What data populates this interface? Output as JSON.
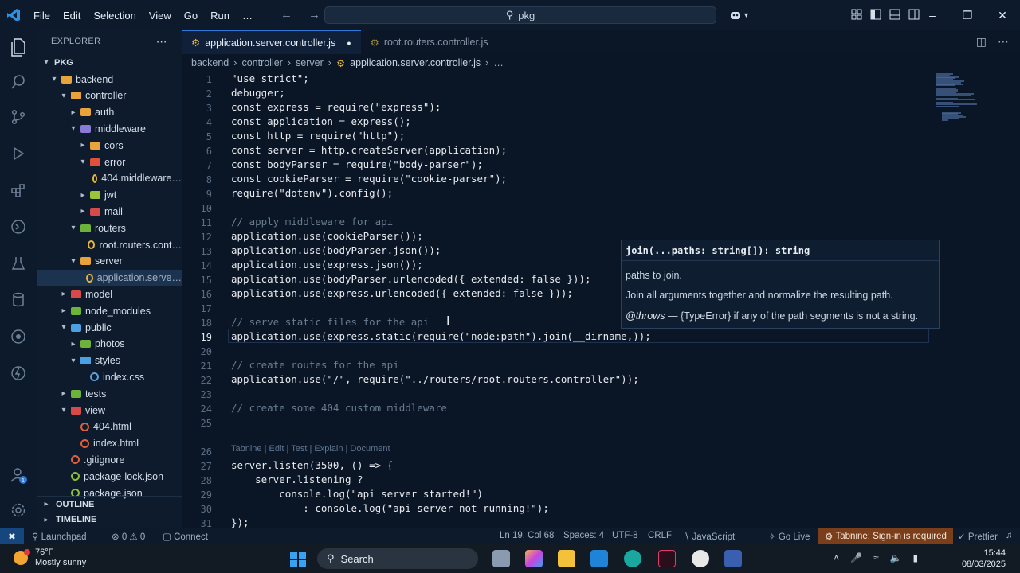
{
  "titlebar": {
    "menu": [
      "File",
      "Edit",
      "Selection",
      "View",
      "Go",
      "Run",
      "…"
    ],
    "search_text": "pkg"
  },
  "explorer": {
    "title": "EXPLORER",
    "root": "PKG",
    "items": [
      {
        "label": "backend",
        "depth": 1,
        "type": "folder",
        "open": true
      },
      {
        "label": "controller",
        "depth": 2,
        "type": "folder",
        "open": true
      },
      {
        "label": "auth",
        "depth": 3,
        "type": "folder",
        "open": false
      },
      {
        "label": "middleware",
        "depth": 3,
        "type": "folder",
        "open": true
      },
      {
        "label": "cors",
        "depth": 4,
        "type": "folder",
        "open": false
      },
      {
        "label": "error",
        "depth": 4,
        "type": "folder",
        "open": true
      },
      {
        "label": "404.middleware…",
        "depth": 5,
        "type": "file"
      },
      {
        "label": "jwt",
        "depth": 4,
        "type": "folder",
        "open": false
      },
      {
        "label": "mail",
        "depth": 4,
        "type": "folder",
        "open": false
      },
      {
        "label": "routers",
        "depth": 3,
        "type": "folder",
        "open": true
      },
      {
        "label": "root.routers.cont…",
        "depth": 4,
        "type": "file"
      },
      {
        "label": "server",
        "depth": 3,
        "type": "folder",
        "open": true
      },
      {
        "label": "application.serve…",
        "depth": 4,
        "type": "file",
        "selected": true
      },
      {
        "label": "model",
        "depth": 2,
        "type": "folder",
        "open": false
      },
      {
        "label": "node_modules",
        "depth": 2,
        "type": "folder",
        "open": false
      },
      {
        "label": "public",
        "depth": 2,
        "type": "folder",
        "open": true
      },
      {
        "label": "photos",
        "depth": 3,
        "type": "folder",
        "open": false
      },
      {
        "label": "styles",
        "depth": 3,
        "type": "folder",
        "open": true
      },
      {
        "label": "index.css",
        "depth": 4,
        "type": "file"
      },
      {
        "label": "tests",
        "depth": 2,
        "type": "folder",
        "open": false
      },
      {
        "label": "view",
        "depth": 2,
        "type": "folder",
        "open": true
      },
      {
        "label": "404.html",
        "depth": 3,
        "type": "file"
      },
      {
        "label": "index.html",
        "depth": 3,
        "type": "file"
      },
      {
        "label": ".gitignore",
        "depth": 2,
        "type": "file"
      },
      {
        "label": "package-lock.json",
        "depth": 2,
        "type": "file"
      },
      {
        "label": "package.json",
        "depth": 2,
        "type": "file"
      }
    ],
    "outline": "OUTLINE",
    "timeline": "TIMELINE"
  },
  "tabs": [
    {
      "label": "application.server.controller.js",
      "active": true
    },
    {
      "label": "root.routers.controller.js",
      "active": false
    }
  ],
  "breadcrumb": [
    "backend",
    "controller",
    "server",
    "application.server.controller.js",
    "…"
  ],
  "code_lines": [
    {
      "n": "1",
      "t": "\"use strict\";"
    },
    {
      "n": "2",
      "t": "debugger;"
    },
    {
      "n": "3",
      "t": "const express = require(\"express\");"
    },
    {
      "n": "4",
      "t": "const application = express();"
    },
    {
      "n": "5",
      "t": "const http = require(\"http\");"
    },
    {
      "n": "6",
      "t": "const server = http.createServer(application);"
    },
    {
      "n": "7",
      "t": "const bodyParser = require(\"body-parser\");"
    },
    {
      "n": "8",
      "t": "const cookieParser = require(\"cookie-parser\");"
    },
    {
      "n": "9",
      "t": "require(\"dotenv\").config();"
    },
    {
      "n": "10",
      "t": ""
    },
    {
      "n": "11",
      "t": "// apply middleware for api"
    },
    {
      "n": "12",
      "t": "application.use(cookieParser());"
    },
    {
      "n": "13",
      "t": "application.use(bodyParser.json());"
    },
    {
      "n": "14",
      "t": "application.use(express.json());"
    },
    {
      "n": "15",
      "t": "application.use(bodyParser.urlencoded({ extended: false }));"
    },
    {
      "n": "16",
      "t": "application.use(express.urlencoded({ extended: false }));"
    },
    {
      "n": "17",
      "t": ""
    },
    {
      "n": "18",
      "t": "// serve static files for the api"
    },
    {
      "n": "19",
      "t": "application.use(express.static(require(\"node:path\").join(__dirname,));"
    },
    {
      "n": "20",
      "t": ""
    },
    {
      "n": "21",
      "t": "// create routes for the api"
    },
    {
      "n": "22",
      "t": "application.use(\"/\", require(\"../routers/root.routers.controller\"));"
    },
    {
      "n": "23",
      "t": ""
    },
    {
      "n": "24",
      "t": "// create some 404 custom middleware"
    },
    {
      "n": "25",
      "t": ""
    },
    {
      "n": "26",
      "t": ""
    },
    {
      "n": "27",
      "t": "server.listen(3500, () => {"
    },
    {
      "n": "28",
      "t": "    server.listening ?"
    },
    {
      "n": "29",
      "t": "        console.log(\"api server started!\")"
    },
    {
      "n": "30",
      "t": "            : console.log(\"api server not running!\");"
    },
    {
      "n": "31",
      "t": "});"
    }
  ],
  "codelens": "Tabnine | Edit | Test | Explain | Document",
  "hover": {
    "signature": "join(...paths: string[]): string",
    "param": "paths to join.",
    "description": "Join all arguments together and normalize the resulting path.",
    "throws_tag": "@throws",
    "throws_text": "— {TypeError} if any of the path segments is not a string."
  },
  "statusbar": {
    "launchpad": "Launchpad",
    "problems": "⊗ 0 ⚠ 0",
    "connect": "Connect",
    "position": "Ln 19, Col 68",
    "spaces": "Spaces: 4",
    "encoding": "UTF-8",
    "eol": "CRLF",
    "language": "JavaScript",
    "golive": "Go Live",
    "tabnine": "Tabnine: Sign-in is required",
    "prettier": "Prettier"
  },
  "taskbar": {
    "temp": "76°F",
    "weather": "Mostly sunny",
    "search": "Search",
    "time": "15:44",
    "date": "08/03/2025"
  },
  "colors": {
    "accent": "#2f7ad8",
    "folder": "#e8a33a",
    "tabnine_bg": "#7a3f1a"
  }
}
